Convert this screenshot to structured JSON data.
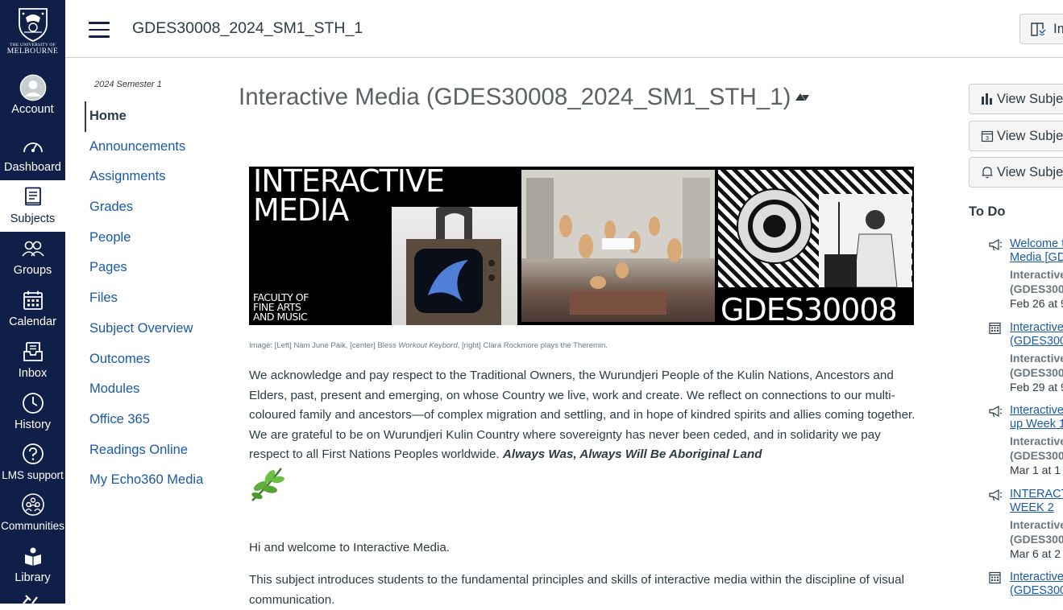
{
  "global_nav": {
    "logo": {
      "line1": "THE UNIVERSITY OF",
      "line2": "MELBOURNE"
    },
    "items": [
      {
        "label": "Account",
        "icon": "account-icon"
      },
      {
        "label": "Dashboard",
        "icon": "dashboard-icon"
      },
      {
        "label": "Subjects",
        "icon": "subjects-icon",
        "active": true
      },
      {
        "label": "Groups",
        "icon": "groups-icon"
      },
      {
        "label": "Calendar",
        "icon": "calendar-icon"
      },
      {
        "label": "Inbox",
        "icon": "inbox-icon"
      },
      {
        "label": "History",
        "icon": "history-icon"
      },
      {
        "label": "LMS support",
        "icon": "help-icon"
      },
      {
        "label": "Communities",
        "icon": "communities-icon"
      },
      {
        "label": "Library",
        "icon": "library-icon"
      }
    ]
  },
  "header": {
    "breadcrumb": "GDES30008_2024_SM1_STH_1",
    "immersive_reader_label": "Im"
  },
  "subject_nav": {
    "term": "2024 Semester 1",
    "items": [
      {
        "label": "Home",
        "active": true
      },
      {
        "label": "Announcements"
      },
      {
        "label": "Assignments"
      },
      {
        "label": "Grades"
      },
      {
        "label": "People"
      },
      {
        "label": "Pages"
      },
      {
        "label": "Files"
      },
      {
        "label": "Subject Overview"
      },
      {
        "label": "Outcomes"
      },
      {
        "label": "Modules"
      },
      {
        "label": "Office 365"
      },
      {
        "label": "Readings Online"
      },
      {
        "label": "My Echo360 Media"
      }
    ]
  },
  "main": {
    "title": "Interactive Media (GDES30008_2024_SM1_STH_1)",
    "banner": {
      "title_line1": "INTERACTIVE",
      "title_line2": "MEDIA",
      "faculty_line1": "FACULTY OF",
      "faculty_line2": "FINE ARTS",
      "faculty_line3": "AND MUSIC",
      "code": "GDES30008"
    },
    "caption_part1": "Image: [Left] Nam June Paik, [center] Bless ",
    "caption_italic": "Workout Keybord",
    "caption_part2": ", [right] Clara Rockmore plays the Theremin.",
    "acknowledgement": "We acknowledge and pay respect to the Traditional Owners, the Wurundjeri People of the Kulin Nations, Ancestors and Elders, past, present and emerging, on whose Country we live, work and create. We reflect on connections to our multi-coloured family and ancestors—of complex migration and settling, and in hope of kindred spirits and allies coming together. We are grateful to be on Wurundjeri Kulin Country where sovereignty has never been ceded, and in solidarity we pay respect to all First Nations Peoples worldwide.",
    "acknowledgement_emphasis": "Always Was, Always Will Be Aboriginal Land",
    "welcome": "Hi and welcome to Interactive Media.",
    "intro": "This subject introduces students to the fundamental principles and skills of interactive media within the discipline of visual communication."
  },
  "right_sidebar": {
    "buttons": [
      {
        "label": "View Subjec",
        "icon": "bar-chart-icon"
      },
      {
        "label": "View Subjec",
        "icon": "calendar-icon"
      },
      {
        "label": "View Subjec",
        "icon": "bell-icon"
      }
    ],
    "todo_heading": "To Do",
    "todo": [
      {
        "icon": "announcement-icon",
        "link1": "Welcome t",
        "link2": "Media [GD",
        "sub1": "Interactive",
        "sub2": "(GDES300",
        "date": "Feb 26 at 9"
      },
      {
        "icon": "calendar-icon",
        "link1": "Interactive",
        "link2": "(GDES300",
        "sub1": "Interactive",
        "sub2": "(GDES300",
        "date": "Feb 29 at 9"
      },
      {
        "icon": "announcement-icon",
        "link1": "Interactive",
        "link2": "up Week 1",
        "sub1": "Interactive",
        "sub2": "(GDES300",
        "date": "Mar 1 at 1"
      },
      {
        "icon": "announcement-icon",
        "link1": "INTERACT",
        "link2": "WEEK 2",
        "sub1": "Interactive",
        "sub2": "(GDES300",
        "date": "Mar 6 at 2"
      },
      {
        "icon": "calendar-icon",
        "link1": "Interactive",
        "link2": "(GDES300"
      }
    ]
  }
}
